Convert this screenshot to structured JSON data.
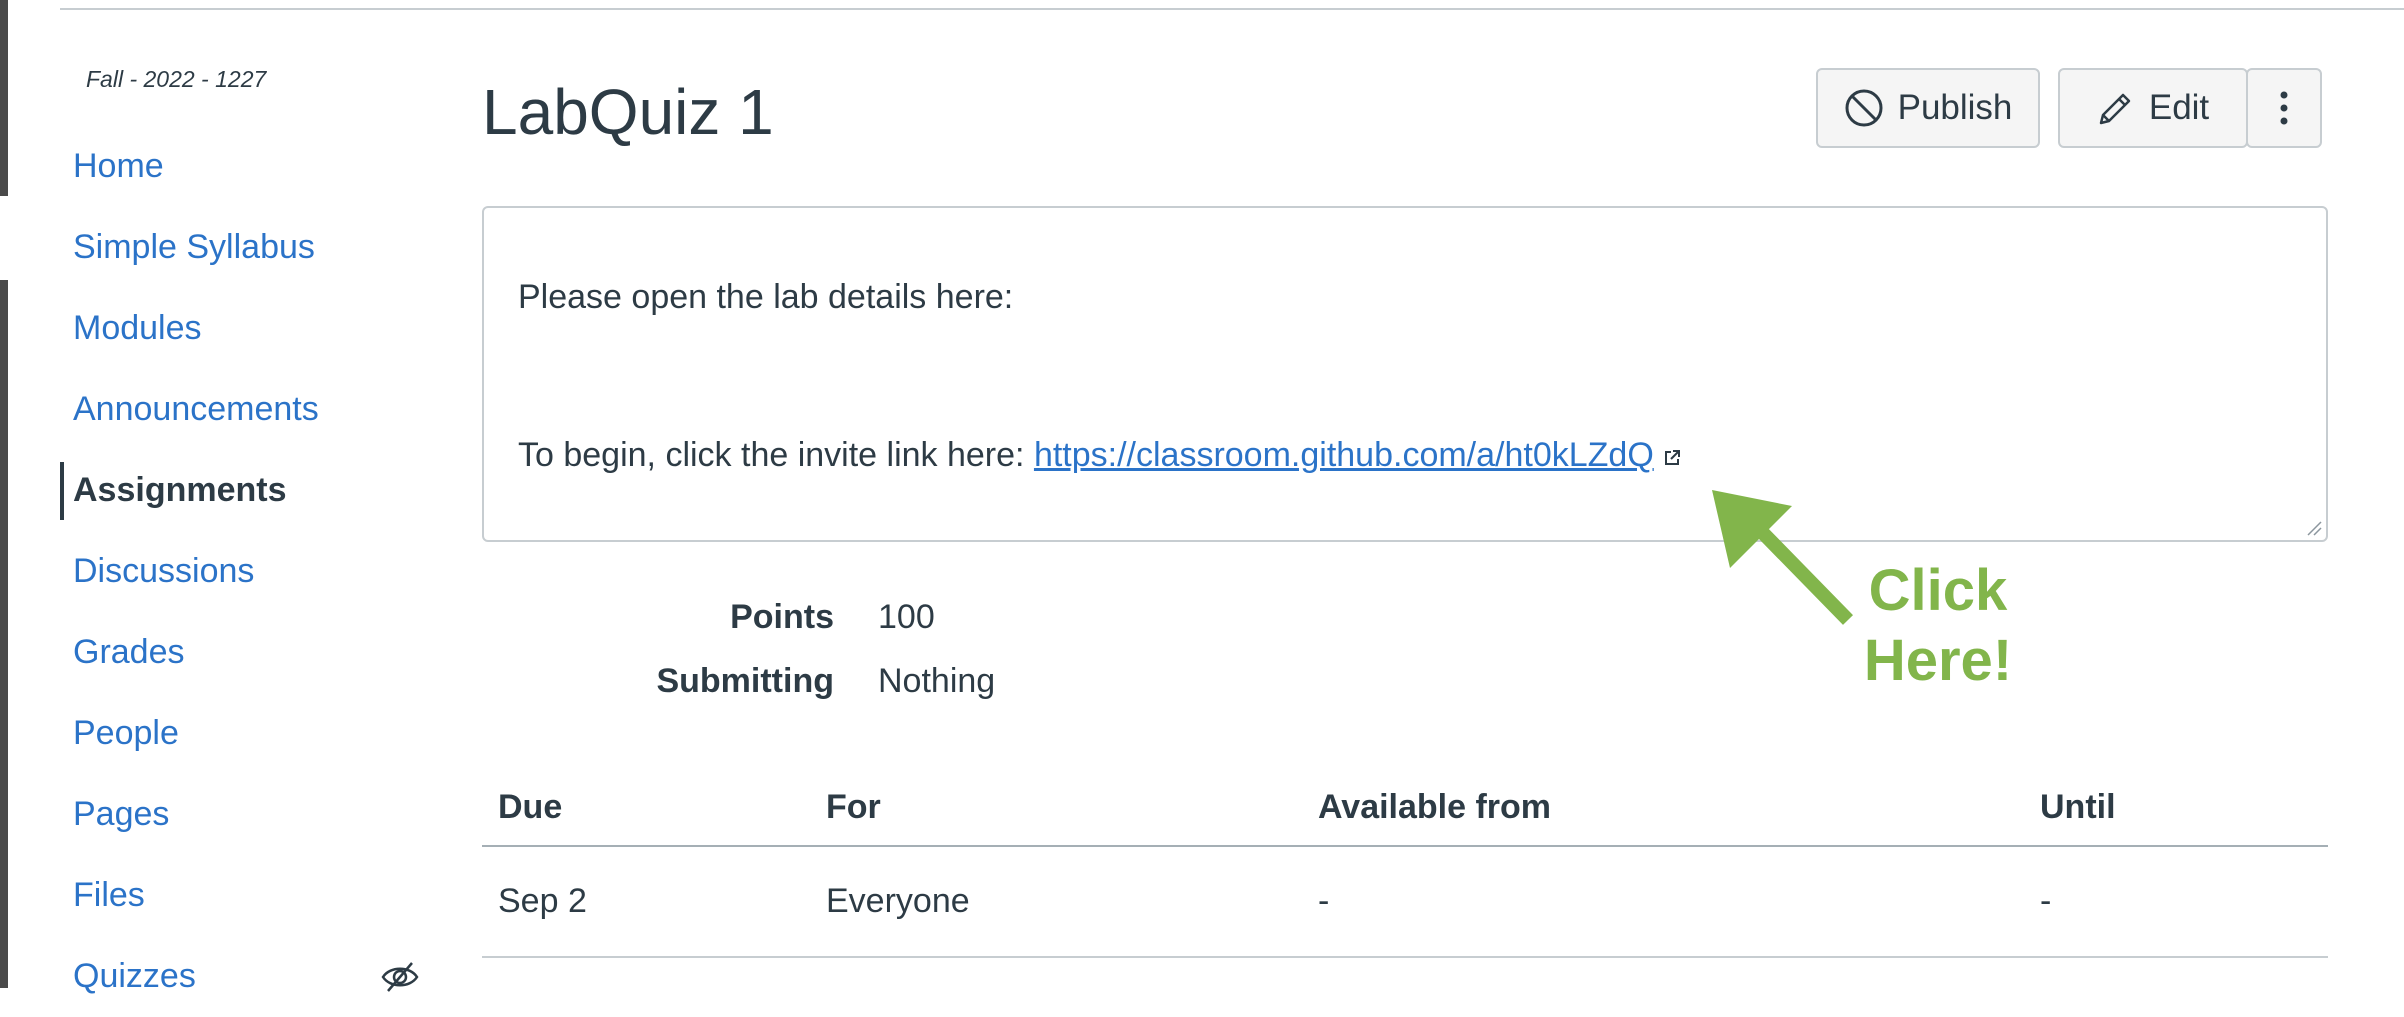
{
  "course": {
    "term": "Fall - 2022 - 1227"
  },
  "nav": {
    "items": [
      {
        "label": "Home"
      },
      {
        "label": "Simple Syllabus"
      },
      {
        "label": "Modules"
      },
      {
        "label": "Announcements"
      },
      {
        "label": "Assignments",
        "active": true
      },
      {
        "label": "Discussions"
      },
      {
        "label": "Grades"
      },
      {
        "label": "People"
      },
      {
        "label": "Pages"
      },
      {
        "label": "Files"
      },
      {
        "label": "Quizzes",
        "icon": "eye-slash-icon"
      }
    ]
  },
  "assignment": {
    "title": "LabQuiz 1",
    "toolbar": {
      "publish_label": "Publish",
      "edit_label": "Edit",
      "more_icon": "kebab-menu-icon"
    },
    "description": {
      "line1": "Please open the lab details here:",
      "line2_prefix": "To begin, click the invite link here: ",
      "link_text": "https://classroom.github.com/a/ht0kLZdQ",
      "link_icon": "external-link-icon"
    },
    "points_label": "Points",
    "points_value": "100",
    "submitting_label": "Submitting",
    "submitting_value": "Nothing"
  },
  "dates_table": {
    "headers": [
      "Due",
      "For",
      "Available from",
      "Until"
    ],
    "rows": [
      [
        "Sep 2",
        "Everyone",
        "-",
        "-"
      ]
    ]
  },
  "annotation": {
    "text_line1": "Click",
    "text_line2": "Here!",
    "color": "#82b54b"
  },
  "colors": {
    "link": "#2b73c8",
    "text": "#2d3b45",
    "border": "#c7cdd1"
  }
}
